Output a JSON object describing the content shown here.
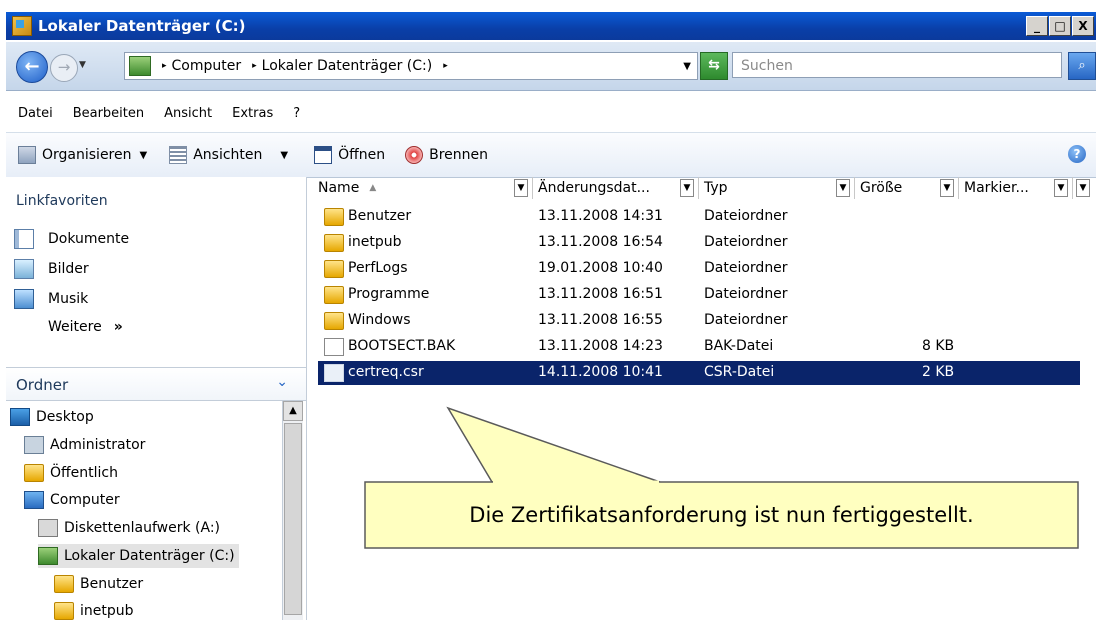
{
  "window": {
    "title": "Lokaler Datenträger (C:)",
    "btn_min": "_",
    "btn_max": "□",
    "btn_close": "X"
  },
  "address": {
    "back": "←",
    "forward": "→",
    "dd": "▼",
    "sep": "▸",
    "segments": [
      "Computer",
      "Lokaler Datenträger (C:)"
    ],
    "dropdown": "▼",
    "search_placeholder": "Suchen",
    "search_glyph": "⌕",
    "refresh_glyph": "⇆"
  },
  "menu": [
    "Datei",
    "Bearbeiten",
    "Ansicht",
    "Extras",
    "?"
  ],
  "toolbar": {
    "organisieren": "Organisieren",
    "ansichten": "Ansichten",
    "oeffnen": "Öffnen",
    "brennen": "Brennen",
    "dd": "▼",
    "help": "?"
  },
  "left": {
    "linkfavoriten": "Linkfavoriten",
    "favorites": [
      "Dokumente",
      "Bilder",
      "Musik"
    ],
    "weitere": "Weitere",
    "weitere_arrows": "»",
    "ordner": "Ordner",
    "ordner_chev": "⌄",
    "tree": [
      "Desktop",
      "Administrator",
      "Öffentlich",
      "Computer",
      "Diskettenlaufwerk (A:)",
      "Lokaler Datenträger (C:)",
      "Benutzer",
      "inetpub"
    ],
    "scroll_up": "▲"
  },
  "columns": [
    "Name",
    "Änderungsdat...",
    "Typ",
    "Größe",
    "Markier..."
  ],
  "sort_glyph": "▲",
  "col_dd": "▼",
  "files": [
    {
      "name": "Benutzer",
      "date": "13.11.2008 14:31",
      "type": "Dateiordner",
      "size": ""
    },
    {
      "name": "inetpub",
      "date": "13.11.2008 16:54",
      "type": "Dateiordner",
      "size": ""
    },
    {
      "name": "PerfLogs",
      "date": "19.01.2008 10:40",
      "type": "Dateiordner",
      "size": ""
    },
    {
      "name": "Programme",
      "date": "13.11.2008 16:51",
      "type": "Dateiordner",
      "size": ""
    },
    {
      "name": "Windows",
      "date": "13.11.2008 16:55",
      "type": "Dateiordner",
      "size": ""
    },
    {
      "name": "BOOTSECT.BAK",
      "date": "13.11.2008 14:23",
      "type": "BAK-Datei",
      "size": "8 KB"
    },
    {
      "name": "certreq.csr",
      "date": "14.11.2008 10:41",
      "type": "CSR-Datei",
      "size": "2 KB"
    }
  ],
  "callout_text": "Die Zertifikatsanforderung ist nun fertiggestellt.",
  "colors": {
    "selection": "#0a246a",
    "callout_fill": "#ffffc0",
    "callout_stroke": "#5a5a5a"
  }
}
